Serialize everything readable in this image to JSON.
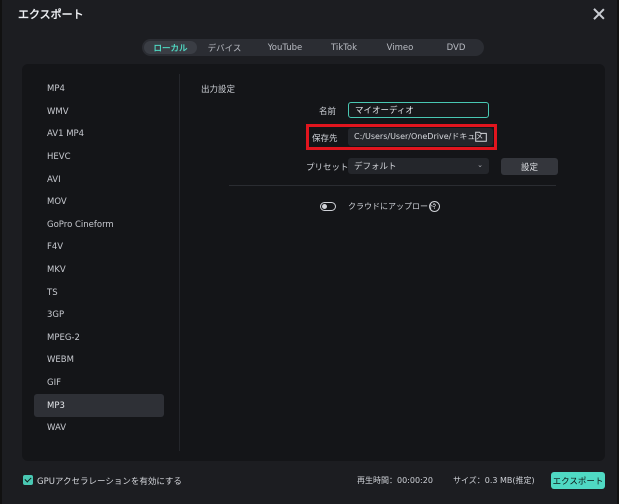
{
  "window": {
    "title": "エクスポート"
  },
  "tabs": [
    {
      "label": "ローカル",
      "active": true
    },
    {
      "label": "デバイス",
      "active": false
    },
    {
      "label": "YouTube",
      "active": false
    },
    {
      "label": "TikTok",
      "active": false
    },
    {
      "label": "Vimeo",
      "active": false
    },
    {
      "label": "DVD",
      "active": false
    }
  ],
  "formats": [
    {
      "label": "MP4"
    },
    {
      "label": "WMV"
    },
    {
      "label": "AV1 MP4"
    },
    {
      "label": "HEVC"
    },
    {
      "label": "AVI"
    },
    {
      "label": "MOV"
    },
    {
      "label": "GoPro Cineform"
    },
    {
      "label": "F4V"
    },
    {
      "label": "MKV"
    },
    {
      "label": "TS"
    },
    {
      "label": "3GP"
    },
    {
      "label": "MPEG-2"
    },
    {
      "label": "WEBM"
    },
    {
      "label": "GIF"
    },
    {
      "label": "MP3",
      "selected": true
    },
    {
      "label": "WAV"
    }
  ],
  "output": {
    "section_title": "出力設定",
    "name_label": "名前",
    "name_value": "マイオーディオ",
    "save_label": "保存先",
    "save_path": "C:/Users/User/OneDrive/ドキュメ",
    "preset_label": "プリセット",
    "preset_value": "デフォルト",
    "settings_button": "設定",
    "cloud_label": "クラウドにアップロード",
    "help_icon": "?"
  },
  "footer": {
    "gpu_label": "GPUアクセラレーションを有効にする",
    "gpu_checked": true,
    "duration": "再生時間：00:00:20",
    "size": "サイズ：0.3 MB(推定)",
    "export_button": "エクスポート"
  },
  "colors": {
    "accent": "#4fd9c3",
    "highlight": "#e1151e",
    "background": "#1c1d21"
  }
}
